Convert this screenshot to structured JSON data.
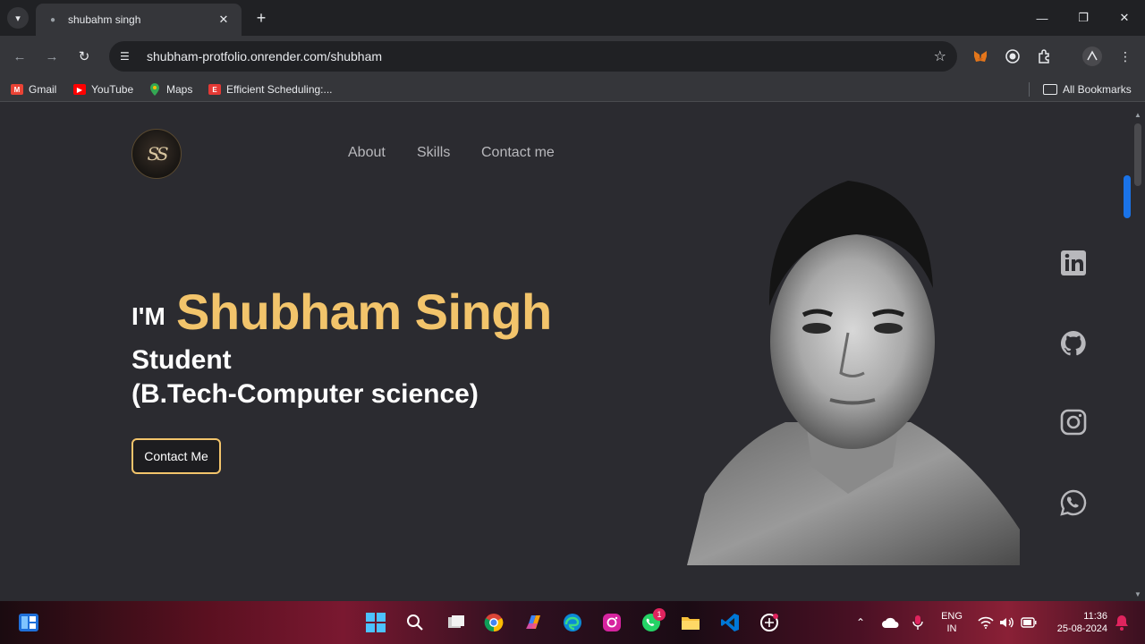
{
  "browser": {
    "tab_title": "shubahm singh",
    "url": "shubham-protfolio.onrender.com/shubham",
    "bookmarks": [
      {
        "label": "Gmail",
        "icon": "gmail-icon",
        "color": "#ea4335"
      },
      {
        "label": "YouTube",
        "icon": "youtube-icon",
        "color": "#ff0000"
      },
      {
        "label": "Maps",
        "icon": "maps-icon",
        "color": "#34a853"
      },
      {
        "label": "Efficient Scheduling:...",
        "icon": "scheduling-icon",
        "color": "#e53935"
      }
    ],
    "all_bookmarks": "All Bookmarks"
  },
  "page": {
    "logo_text": "SS",
    "nav": [
      "About",
      "Skills",
      "Contact me"
    ],
    "hero": {
      "prefix": "I'M",
      "name": "Shubham Singh",
      "role_line1": "Student",
      "role_line2": "(B.Tech-Computer science)",
      "cta": "Contact Me"
    },
    "social": [
      "linkedin-icon",
      "github-icon",
      "instagram-icon",
      "whatsapp-icon"
    ],
    "colors": {
      "accent": "#f2c46b",
      "background": "#2b2b30",
      "nav_text": "#b8b8bc"
    }
  },
  "taskbar": {
    "language": "ENG",
    "region": "IN",
    "time": "11:36",
    "date": "25-08-2024",
    "whatsapp_badge": "1"
  }
}
